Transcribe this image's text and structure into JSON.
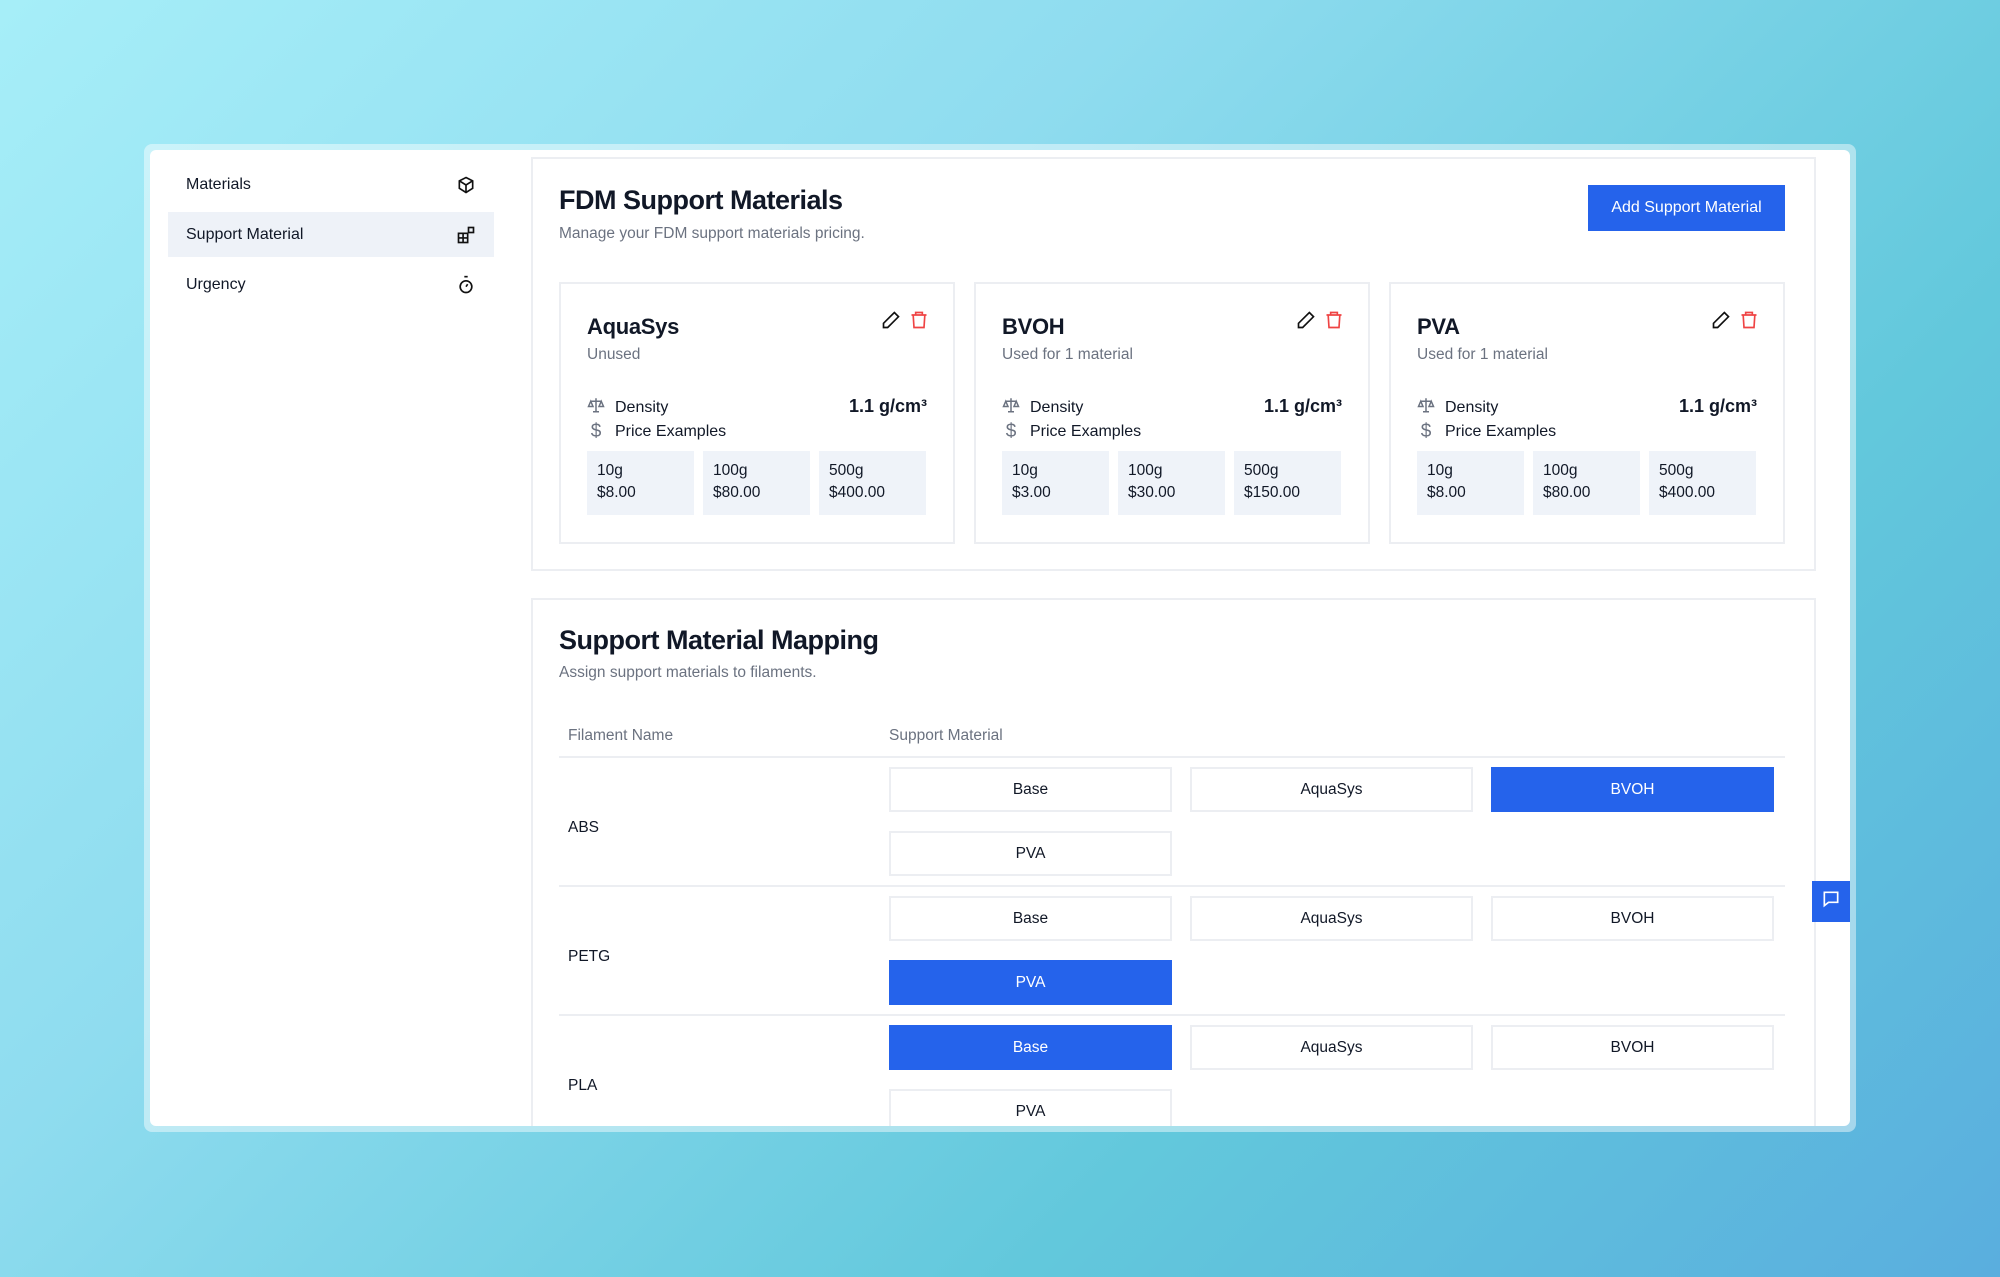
{
  "sidebar": {
    "items": [
      {
        "label": "Materials",
        "icon": "cube-icon",
        "active": false
      },
      {
        "label": "Support Material",
        "icon": "shapes-icon",
        "active": true
      },
      {
        "label": "Urgency",
        "icon": "timer-icon",
        "active": false
      }
    ]
  },
  "support": {
    "title": "FDM Support Materials",
    "subtitle": "Manage your FDM support materials pricing.",
    "add_label": "Add Support Material",
    "density_label": "Density",
    "price_label": "Price Examples",
    "cards": [
      {
        "name": "AquaSys",
        "usage": "Unused",
        "density": "1.1 g/cm³",
        "prices": [
          {
            "w": "10g",
            "p": "$8.00"
          },
          {
            "w": "100g",
            "p": "$80.00"
          },
          {
            "w": "500g",
            "p": "$400.00"
          }
        ]
      },
      {
        "name": "BVOH",
        "usage": "Used for 1 material",
        "density": "1.1 g/cm³",
        "prices": [
          {
            "w": "10g",
            "p": "$3.00"
          },
          {
            "w": "100g",
            "p": "$30.00"
          },
          {
            "w": "500g",
            "p": "$150.00"
          }
        ]
      },
      {
        "name": "PVA",
        "usage": "Used for 1 material",
        "density": "1.1 g/cm³",
        "prices": [
          {
            "w": "10g",
            "p": "$8.00"
          },
          {
            "w": "100g",
            "p": "$80.00"
          },
          {
            "w": "500g",
            "p": "$400.00"
          }
        ]
      }
    ]
  },
  "mapping": {
    "title": "Support Material Mapping",
    "subtitle": "Assign support materials to filaments.",
    "col_filament": "Filament Name",
    "col_support": "Support Material",
    "options": [
      "Base",
      "AquaSys",
      "BVOH",
      "PVA"
    ],
    "rows": [
      {
        "filament": "ABS",
        "selected": "BVOH"
      },
      {
        "filament": "PETG",
        "selected": "PVA"
      },
      {
        "filament": "PLA",
        "selected": "Base"
      }
    ]
  },
  "colors": {
    "accent": "#2563eb",
    "danger": "#ef4444"
  }
}
